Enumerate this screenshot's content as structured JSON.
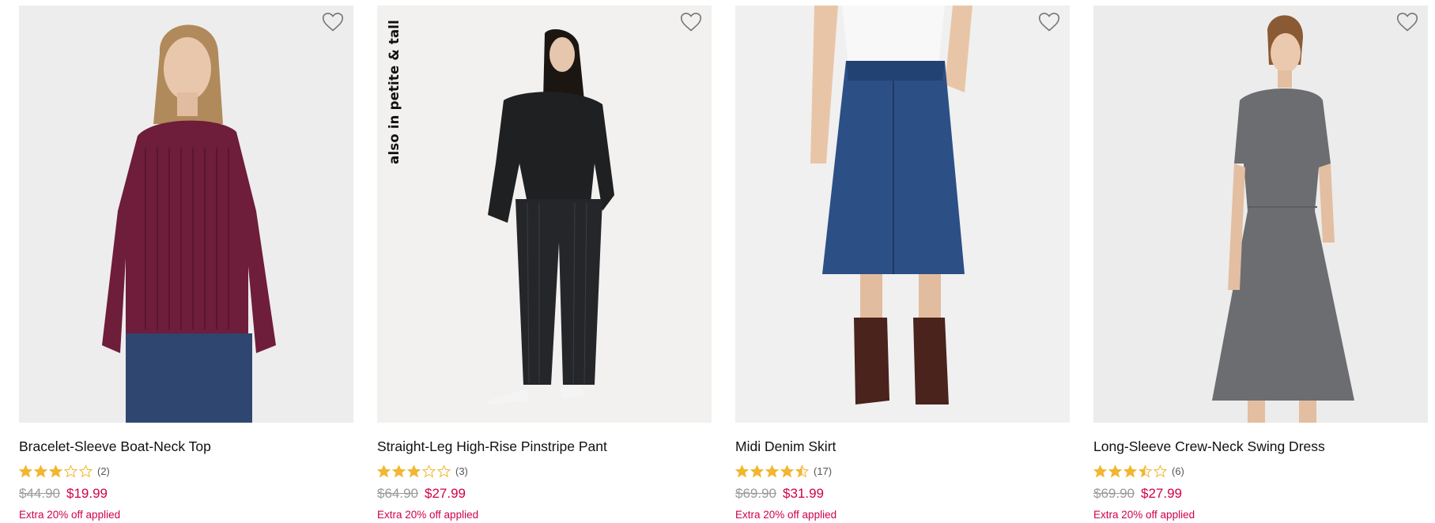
{
  "colors": {
    "sale": "#d1004c",
    "star": "#f2b630",
    "strike": "#9a9a9a"
  },
  "products": [
    {
      "name": "Bracelet-Sleeve Boat-Neck Top",
      "rating": 3,
      "review_count": "(2)",
      "was_price": "$44.90",
      "sale_price": "$19.99",
      "promo": "Extra 20% off applied",
      "flag": ""
    },
    {
      "name": "Straight-Leg High-Rise Pinstripe Pant",
      "rating": 3,
      "review_count": "(3)",
      "was_price": "$64.90",
      "sale_price": "$27.99",
      "promo": "Extra 20% off applied",
      "flag": "also in petite & tall"
    },
    {
      "name": "Midi Denim Skirt",
      "rating": 4.5,
      "review_count": "(17)",
      "was_price": "$69.90",
      "sale_price": "$31.99",
      "promo": "Extra 20% off applied",
      "flag": ""
    },
    {
      "name": "Long-Sleeve Crew-Neck Swing Dress",
      "rating": 3.5,
      "review_count": "(6)",
      "was_price": "$69.90",
      "sale_price": "$27.99",
      "promo": "Extra 20% off applied",
      "flag": ""
    }
  ]
}
